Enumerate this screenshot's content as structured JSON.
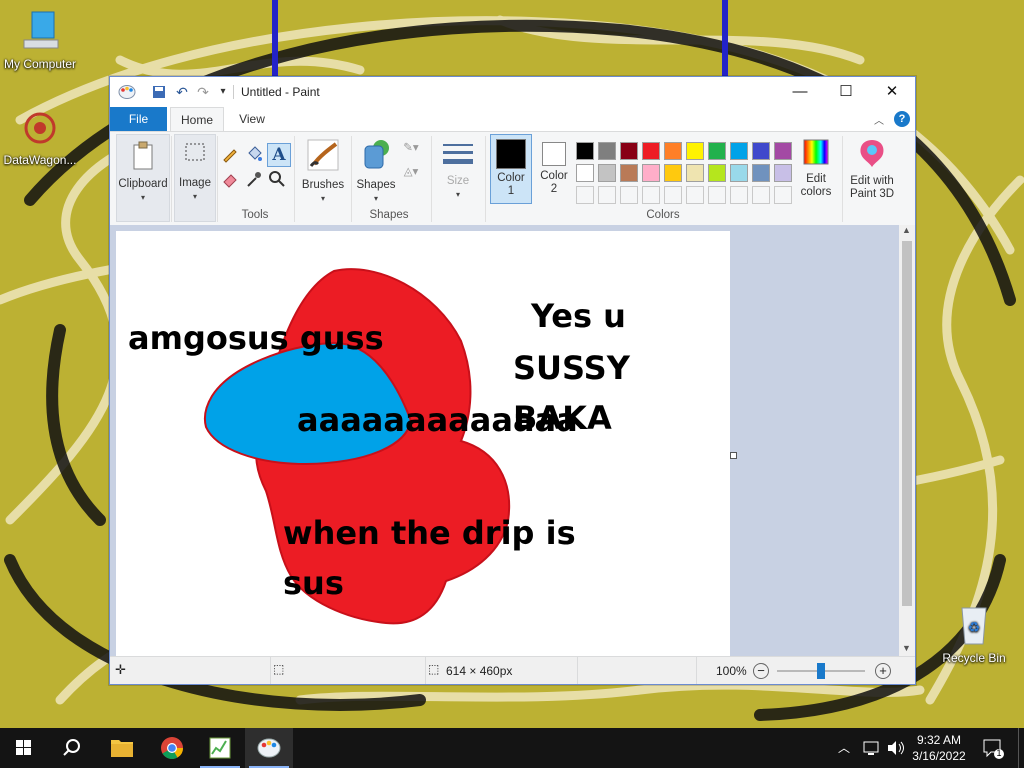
{
  "desktop": {
    "icons": [
      {
        "label": "My Computer"
      },
      {
        "label": "DataWagon..."
      },
      {
        "label": "Recycle Bin"
      }
    ]
  },
  "window": {
    "title": "Untitled - Paint",
    "tabs": [
      "File",
      "Home",
      "View"
    ],
    "ribbon": {
      "clipboard": "Clipboard",
      "image": "Image",
      "tools_group": "Tools",
      "brushes": "Brushes",
      "shapes_btn": "Shapes",
      "shapes_group": "Shapes",
      "size": "Size",
      "color1": "Color 1",
      "color2": "Color 2",
      "colors_group": "Colors",
      "edit_colors": "Edit colors",
      "paint3d": "Edit with Paint 3D"
    },
    "colors": {
      "color1": "#000000",
      "color2": "#ffffff",
      "palette_row1": [
        "#000000",
        "#7f7f7f",
        "#880015",
        "#ed1c24",
        "#ff7f27",
        "#fff200",
        "#22b14c",
        "#00a2e8",
        "#3f48cc",
        "#a349a4"
      ],
      "palette_row2": [
        "#ffffff",
        "#c3c3c3",
        "#b97a57",
        "#ffaec9",
        "#ffc90e",
        "#efe4b0",
        "#b5e61d",
        "#99d9ea",
        "#7092be",
        "#c8bfe7"
      ]
    },
    "canvas_text": {
      "t1": "amgosus guss",
      "t2": "Yes u",
      "t3": "SUSSY",
      "t4": "BAKA",
      "t5": "aaaaaaaaaaaaa",
      "t6": "when the drip is",
      "t7": "sus"
    },
    "status": {
      "size": "614 × 460px",
      "zoom": "100%",
      "zoom_level": 1.0
    }
  },
  "taskbar": {
    "time": "9:32 AM",
    "date": "3/16/2022",
    "notifications": "1"
  }
}
